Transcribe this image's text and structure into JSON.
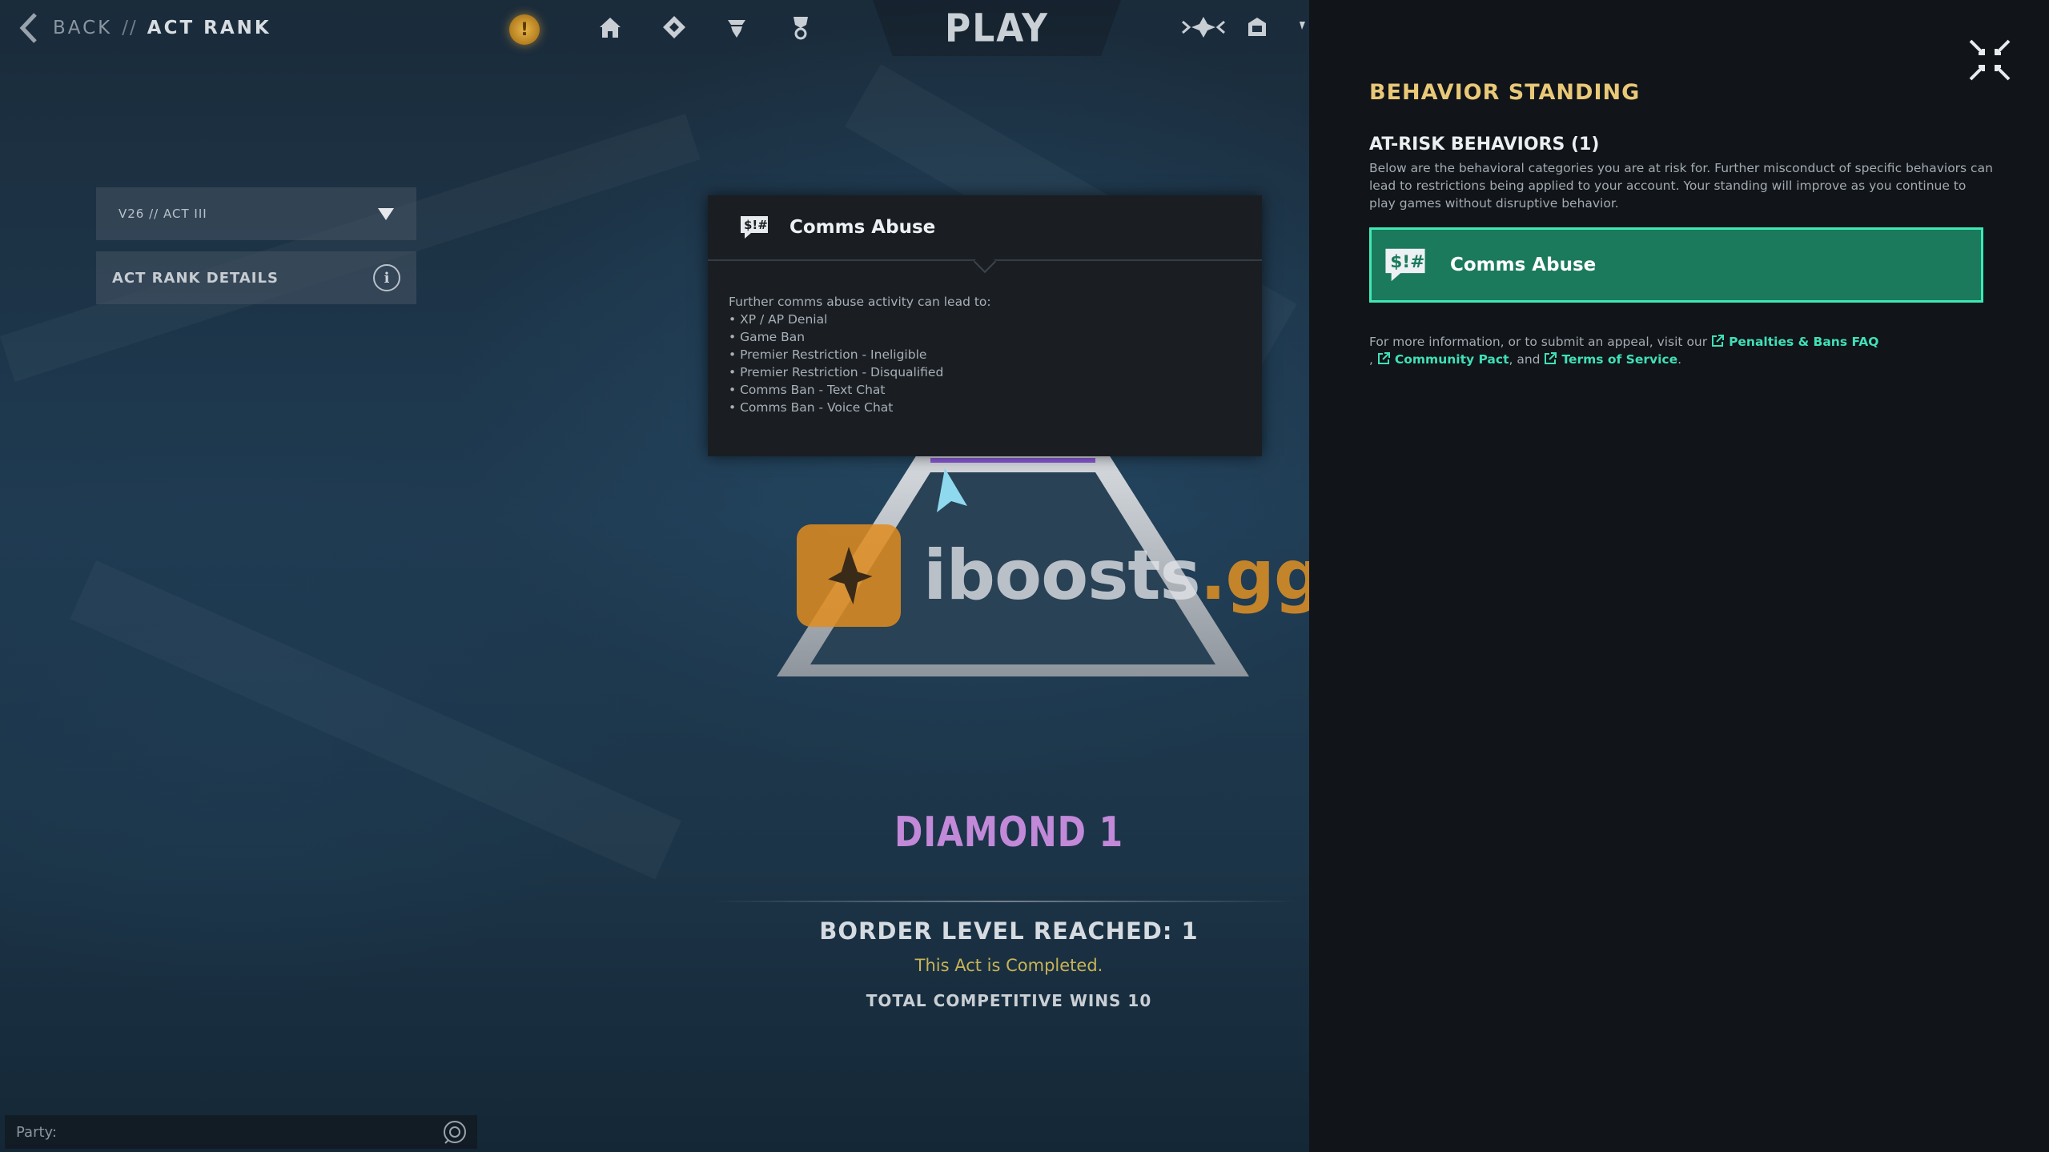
{
  "nav": {
    "back_label": "BACK",
    "separator": "//",
    "current_page": "ACT RANK",
    "alert_glyph": "!",
    "play_label": "PLAY",
    "icons": [
      "home-icon",
      "battlepass-icon",
      "agents-icon",
      "career-icon",
      "store-icon",
      "collection-icon"
    ]
  },
  "act_selector": {
    "value": "V26 // ACT III",
    "details_label": "ACT RANK DETAILS",
    "info_glyph": "i"
  },
  "tooltip": {
    "title": "Comms Abuse",
    "intro": "Further comms abuse activity can lead to:",
    "items": [
      "• XP / AP Denial",
      "• Game Ban",
      "• Premier Restriction - Ineligible",
      "• Premier Restriction - Disqualified",
      "• Comms Ban - Text Chat",
      "• Comms Ban - Voice Chat"
    ]
  },
  "rank": {
    "name": "DIAMOND 1",
    "border_level": "BORDER LEVEL REACHED: 1",
    "act_status": "This Act is Completed.",
    "total_wins": "TOTAL COMPETITIVE WINS 10"
  },
  "watermark": {
    "text_main": "iboosts",
    "text_suffix": ".gg"
  },
  "party": {
    "label": "Party:"
  },
  "behavior_panel": {
    "title": "BEHAVIOR STANDING",
    "at_risk_heading": "AT-RISK BEHAVIORS (1)",
    "at_risk_description": "Below are the behavioral categories you are at risk for. Further misconduct of specific behaviors can lead to restrictions being applied to your account. Your standing will improve as you continue to play games without disruptive behavior.",
    "behavior_card_label": "Comms Abuse",
    "more_info_prefix": "For more information, or to submit an appeal, visit our",
    "links": {
      "penalties": "Penalties & Bans FAQ",
      "community": "Community Pact",
      "terms": "Terms of Service"
    },
    "comma": ",",
    "and_text": ", and",
    "period": "."
  },
  "colors": {
    "panel_title": "#e9c978",
    "card_fill": "#1b7a5c",
    "card_border": "#3ee8b5",
    "link": "#3fe0b8",
    "rank_name": "#c189d8",
    "act_status": "#c9b356"
  }
}
